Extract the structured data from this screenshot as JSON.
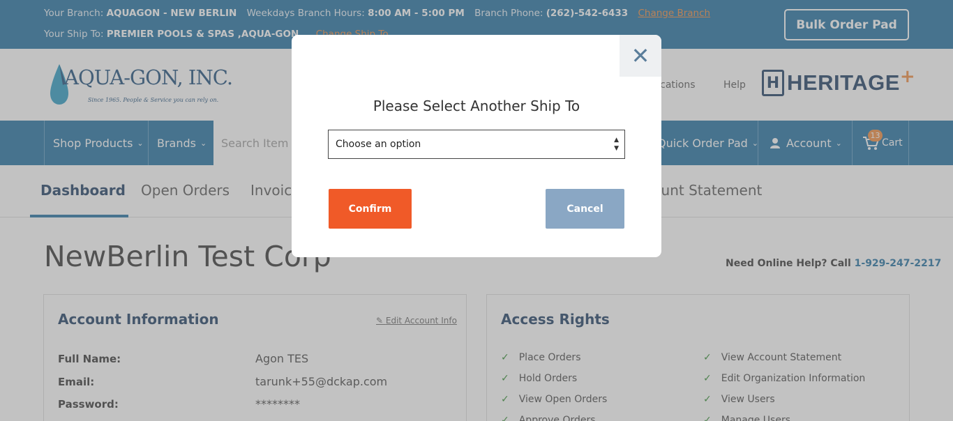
{
  "topbar": {
    "branch_label": "Your Branch:",
    "branch_value": "AQUAGON - NEW BERLIN",
    "hours_label": "Weekdays Branch Hours:",
    "hours_value": "8:00 AM - 5:00 PM",
    "phone_label": "Branch Phone:",
    "phone_value": "(262)-542-6433",
    "change_branch": "Change Branch",
    "shipto_label": "Your Ship To:",
    "shipto_value": "PREMIER POOLS & SPAS ,AQUA-GON,, ,",
    "change_shipto": "Change Ship To",
    "bulk_order": "Bulk Order Pad"
  },
  "header": {
    "logo_name": "AQUA-GON, INC.",
    "logo_tagline": "Since 1965. People & Service you can rely on.",
    "locations": "Locations",
    "help": "Help",
    "partner_logo": "HERITAGE",
    "partner_plus": "+"
  },
  "nav": {
    "shop_products": "Shop Products",
    "brands": "Brands",
    "search_placeholder": "Search Item #",
    "quick_order": "Quick Order Pad",
    "account": "Account",
    "cart": "Cart",
    "cart_count": "13"
  },
  "tabs": [
    "Dashboard",
    "Open Orders",
    "Invoices",
    "Account Statement"
  ],
  "main": {
    "title": "NewBerlin Test Corp",
    "help_text": "Need Online Help? Call",
    "help_phone": "1-929-247-2217"
  },
  "account_info": {
    "heading": "Account Information",
    "edit_link": "Edit Account Info",
    "rows": [
      {
        "label": "Full Name:",
        "value": "Agon TES"
      },
      {
        "label": "Email:",
        "value": "tarunk+55@dckap.com"
      },
      {
        "label": "Password:",
        "value": "********"
      }
    ]
  },
  "access_rights": {
    "heading": "Access Rights",
    "left": [
      "Place Orders",
      "Hold Orders",
      "View Open Orders",
      "Approve Orders"
    ],
    "right": [
      "View Account Statement",
      "Edit Organization Information",
      "View Users",
      "Manage Users"
    ]
  },
  "modal": {
    "title": "Please Select Another Ship To",
    "select_value": "Choose an option",
    "confirm": "Confirm",
    "cancel": "Cancel"
  },
  "colors": {
    "brand_blue": "#1f6fa0",
    "accent_orange": "#f05a28",
    "cancel_gray_blue": "#8aa7c4"
  }
}
